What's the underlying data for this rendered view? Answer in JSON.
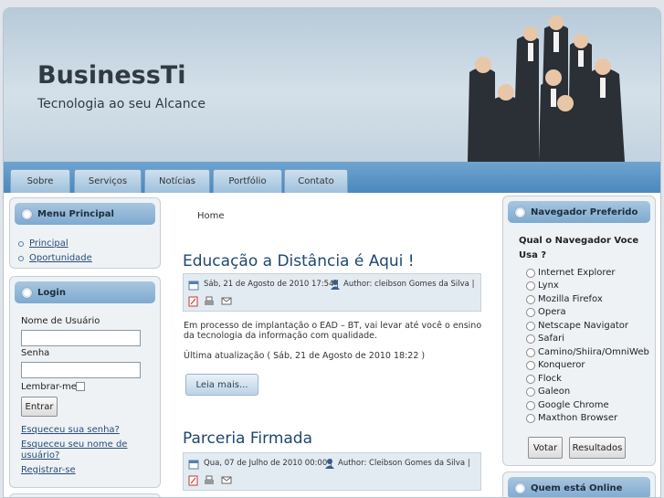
{
  "site": {
    "title": "BusinessTi",
    "slogan": "Tecnologia ao seu Alcance"
  },
  "nav": [
    "Sobre",
    "Serviços",
    "Notícias",
    "Portfólio",
    "Contato"
  ],
  "menu": {
    "title": "Menu Principal",
    "items": [
      "Principal",
      "Oportunidade"
    ]
  },
  "login": {
    "title": "Login",
    "username_label": "Nome de Usuário",
    "username_value": "",
    "password_label": "Senha",
    "password_value": "",
    "remember_label": "Lembrar-me",
    "enter_label": "Entrar",
    "forgot_password": "Esqueceu sua senha?",
    "forgot_username": "Esqueceu seu nome de usuário?",
    "register": "Registrar-se"
  },
  "breadcrumb": "Home",
  "articles": [
    {
      "title": "Educação a Distância é Aqui !",
      "date": "Sáb, 21 de Agosto de 2010 17:54 |",
      "author": "Author: cleibson Gomes da Silva |",
      "body": "Em processo de implantação o EAD – BT, vai levar até você o ensino da tecnologia da informação com qualidade.",
      "updated": "Última atualização ( Sáb, 21 de Agosto de 2010 18:22 )",
      "read_more": "Leia mais..."
    },
    {
      "title": "Parceria Firmada",
      "date": "Qua, 07 de Julho de 2010 00:00 |",
      "author": "Author: Cleibson Gomes da Silva |"
    }
  ],
  "poll": {
    "title": "Navegador Preferido",
    "question": "Qual o Navegador Voce Usa ?",
    "options": [
      "Internet Explorer",
      "Lynx",
      "Mozilla Firefox",
      "Opera",
      "Netscape Navigator",
      "Safari",
      "Camino/Shiira/OmniWeb",
      "Konqueror",
      "Flock",
      "Galeon",
      "Google Chrome",
      "Maxthon Browser"
    ],
    "vote_label": "Votar",
    "results_label": "Resultados"
  },
  "online": {
    "title": "Quem está Online"
  },
  "icons": [
    "calendar-icon",
    "user-icon",
    "pdf-icon",
    "print-icon",
    "email-icon"
  ],
  "colors": {
    "header": "#c3d3df",
    "nav": "#4b88bd",
    "title": "#1f4771",
    "link": "#2a4c78"
  }
}
